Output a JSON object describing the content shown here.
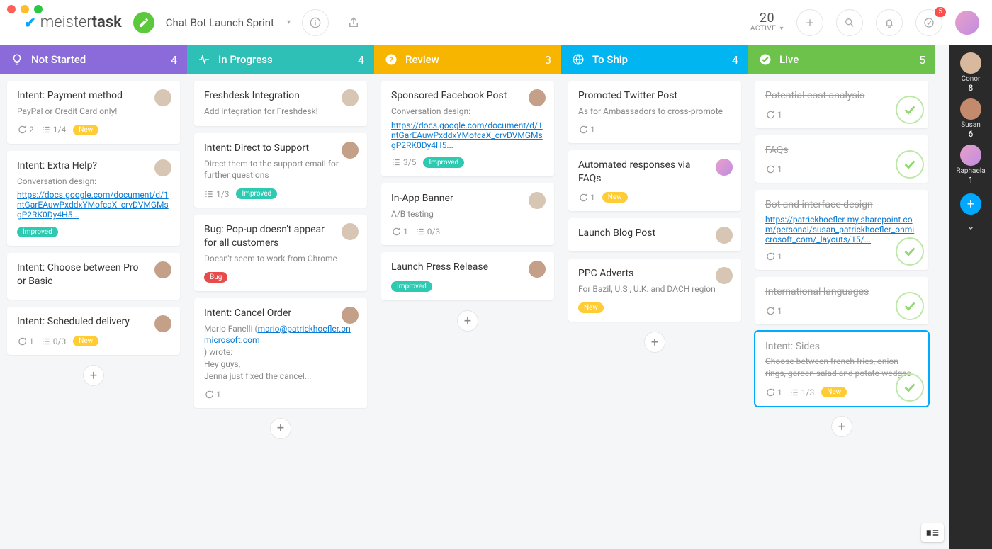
{
  "app": {
    "brand_left": "meister",
    "brand_right": "task"
  },
  "header": {
    "workspace_name": "Chat Bot Launch Sprint",
    "active_count": "20",
    "active_label": "ACTIVE",
    "notif_badge": "5"
  },
  "members": [
    {
      "name": "Conor",
      "count": "8",
      "color": "#d9b99d"
    },
    {
      "name": "Susan",
      "count": "6",
      "color": "#c48a6e"
    },
    {
      "name": "Raphaela",
      "count": "1",
      "color": "linear-gradient(135deg,#e9a0c9,#c08de0)"
    }
  ],
  "columns": [
    {
      "id": "not-started",
      "title": "Not Started",
      "count": "4",
      "color": "#8b6bd9",
      "icon": "bulb",
      "cards": [
        {
          "title": "Intent: Payment method",
          "desc": "PayPal or Credit Card only!",
          "assignee": "a1",
          "comments": "2",
          "checklist": "1/4",
          "tags": [
            "New"
          ]
        },
        {
          "title": "Intent: Extra Help?",
          "desc": "Conversation design:",
          "link": "https://docs.google.com/document/d/1ntGarEAuwPxddxYMofcaX_crvDVMGMsgP2RK0Dy4H5...",
          "assignee": "a1",
          "tags": [
            "Improved"
          ]
        },
        {
          "title": "Intent: Choose between Pro or Basic",
          "assignee": "a2"
        },
        {
          "title": "Intent: Scheduled delivery",
          "assignee": "a2",
          "comments": "1",
          "checklist": "0/3",
          "tags": [
            "New"
          ]
        }
      ]
    },
    {
      "id": "in-progress",
      "title": "In Progress",
      "count": "4",
      "color": "#2ebfb6",
      "icon": "pulse",
      "cards": [
        {
          "title": "Freshdesk Integration",
          "desc": "Add integration for Freshdesk!",
          "assignee": "a1"
        },
        {
          "title": "Intent: Direct to Support",
          "desc": "Direct them to the support email for further questions",
          "assignee": "a2",
          "checklist": "1/3",
          "tags": [
            "Improved"
          ]
        },
        {
          "title": "Bug: Pop-up doesn't appear for all customers",
          "desc": "Doesn't seem to work from Chrome",
          "assignee": "a1",
          "tags": [
            "Bug"
          ]
        },
        {
          "title": "Intent: Cancel Order",
          "assignee": "a2",
          "body_lines": [
            "Mario Fanelli (",
            "mario@patrickhoefler.onmicrosoft.com",
            ") wrote:",
            "Hey guys,",
            "Jenna just fixed the cancel..."
          ],
          "comments": "1"
        }
      ]
    },
    {
      "id": "review",
      "title": "Review",
      "count": "3",
      "color": "#f7b500",
      "icon": "question",
      "cards": [
        {
          "title": "Sponsored Facebook Post",
          "desc": "Conversation design:",
          "link": "https://docs.google.com/document/d/1ntGarEAuwPxddxYMofcaX_crvDVMGMsgP2RK0Dy4H5...",
          "assignee": "a2",
          "checklist": "3/5",
          "tags": [
            "Improved"
          ]
        },
        {
          "title": "In-App Banner",
          "desc": "A/B testing",
          "assignee": "a1",
          "comments": "1",
          "checklist": "0/3"
        },
        {
          "title": "Launch Press Release",
          "assignee": "a2",
          "tags": [
            "Improved"
          ]
        }
      ]
    },
    {
      "id": "to-ship",
      "title": "To Ship",
      "count": "4",
      "color": "#00b5f0",
      "icon": "globe",
      "cards": [
        {
          "title": "Promoted Twitter Post",
          "desc": "As for Ambassadors to cross-promote",
          "comments": "1"
        },
        {
          "title": "Automated responses via FAQs",
          "assignee": "a4",
          "comments": "1",
          "tags": [
            "New"
          ]
        },
        {
          "title": "Launch Blog Post",
          "assignee": "a1"
        },
        {
          "title": "PPC Adverts",
          "desc": "For Bazil, U.S , U.K. and DACH region",
          "assignee": "a1",
          "tags": [
            "New"
          ]
        }
      ]
    },
    {
      "id": "live",
      "title": "Live",
      "count": "5",
      "color": "#6cc24a",
      "icon": "check",
      "cards": [
        {
          "title": "Potential cost analysis",
          "done": true,
          "comments": "1"
        },
        {
          "title": "FAQs",
          "done": true,
          "comments": "1"
        },
        {
          "title": "Bot and interface design",
          "done": true,
          "link": "https://patrickhoefler-my.sharepoint.com/personal/susan_patrickhoefler_onmicrosoft_com/_layouts/15/...",
          "comments": "1"
        },
        {
          "title": "International languages",
          "done": true,
          "comments": "1"
        },
        {
          "title": "Intent: Sides",
          "done": true,
          "selected": true,
          "desc": "Choose between french fries, onion rings, garden salad and potato wedges",
          "comments": "1",
          "checklist": "1/3",
          "tags": [
            "New"
          ]
        }
      ]
    }
  ]
}
